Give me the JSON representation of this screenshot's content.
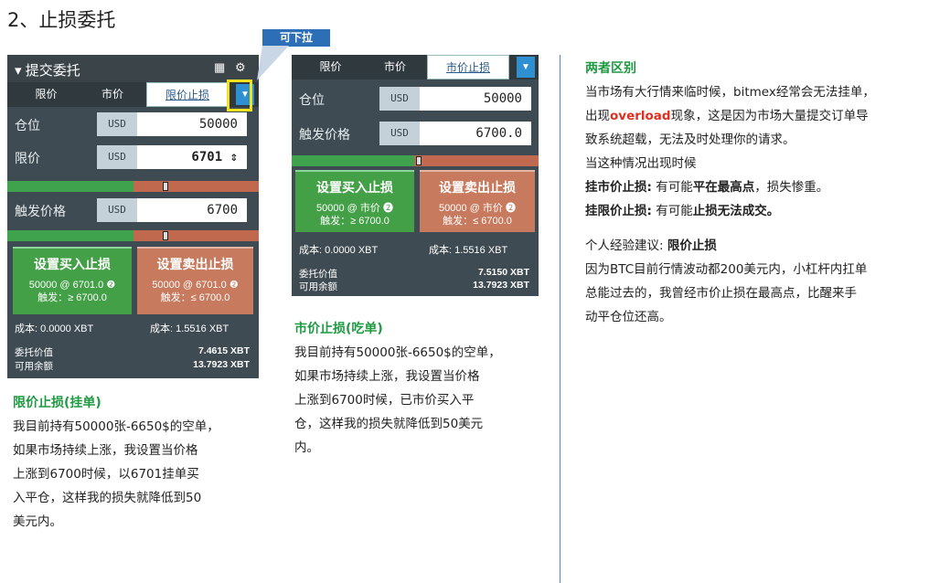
{
  "heading": "2、止损委托",
  "callout": "可下拉",
  "panelA": {
    "title": "提交委托",
    "tabs": [
      "限价",
      "市价",
      "限价止损"
    ],
    "rows": [
      {
        "label": "仓位",
        "unit": "USD",
        "value": "50000"
      },
      {
        "label": "限价",
        "unit": "USD",
        "value": "6701 ⇕"
      },
      {
        "label": "触发价格",
        "unit": "USD",
        "value": "6700"
      }
    ],
    "buy": {
      "title": "设置买入止损",
      "line1": "50000 @ 6701.0",
      "line2": "触发：≥ 6700.0"
    },
    "sell": {
      "title": "设置卖出止损",
      "line1": "50000 @ 6701.0",
      "line2": "触发：≤ 6700.0"
    },
    "cost_buy": "成本: 0.0000 XBT",
    "cost_sell": "成本: 1.5516 XBT",
    "order_value_label": "委托价值",
    "order_value": "7.4615 XBT",
    "available_label": "可用余额",
    "available": "13.7923 XBT"
  },
  "panelB": {
    "tabs": [
      "限价",
      "市价",
      "市价止损"
    ],
    "rows": [
      {
        "label": "仓位",
        "unit": "USD",
        "value": "50000"
      },
      {
        "label": "触发价格",
        "unit": "USD",
        "value": "6700.0"
      }
    ],
    "buy": {
      "title": "设置买入止损",
      "line1": "50000 @ 市价",
      "line2": "触发：≥ 6700.0"
    },
    "sell": {
      "title": "设置卖出止损",
      "line1": "50000 @ 市价",
      "line2": "触发：≤ 6700.0"
    },
    "cost_buy": "成本: 0.0000 XBT",
    "cost_sell": "成本: 1.5516 XBT",
    "order_value_label": "委托价值",
    "order_value": "7.5150 XBT",
    "available_label": "可用余额",
    "available": "13.7923 XBT"
  },
  "textA": {
    "title": "限价止损(挂单)",
    "lines": [
      "我目前持有50000张-6650$的空单，",
      "如果市场持续上涨，我设置当价格",
      "上涨到6700时候，以6701挂单买",
      "入平仓，这样我的损失就降低到50",
      "美元内。"
    ]
  },
  "textB": {
    "title": "市价止损(吃单)",
    "lines": [
      "我目前持有50000张-6650$的空单，",
      "如果市场持续上涨，我设置当价格",
      "上涨到6700时候，已市价买入平",
      "仓，这样我的损失就降低到50美元",
      "内。"
    ]
  },
  "textC": {
    "title": "两者区别",
    "l1": "当市场有大行情来临时候，bitmex经常会无法挂单，",
    "l2a": "出现",
    "l2b": "overload",
    "l2c": "现象，这是因为市场大量提交订单导",
    "l3": "致系统超载，无法及时处理你的请求。",
    "l4": "当这种情况出现时候",
    "l5a": "挂市价止损:",
    "l5b": " 有可能",
    "l5c": "平在最高点",
    "l5d": "，损失惨重。",
    "l6a": "挂限价止损:",
    "l6b": " 有可能",
    "l6c": "止损无法成交。",
    "l7a": "个人经验建议: ",
    "l7b": "限价止损",
    "l8": "因为BTC目前行情波动都200美元内，小杠杆内扛单",
    "l9": "总能过去的，我曾经市价止损在最高点，比醒来手",
    "l10": "动平仓位还高。"
  }
}
